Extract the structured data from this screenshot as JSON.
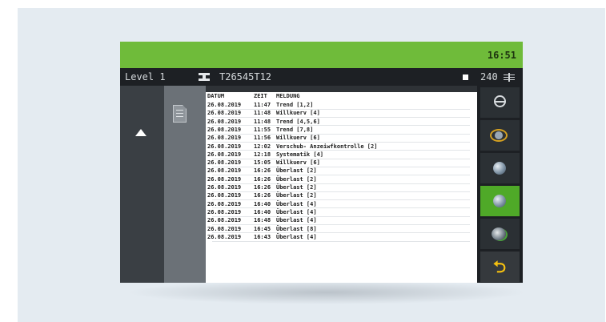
{
  "header": {
    "time": "16:51"
  },
  "status": {
    "level": "Level 1",
    "tool_icon": "tool-icon",
    "serial": "T26545T12",
    "stop_icon": "square-icon",
    "count": "240",
    "count_icon": "count-icon"
  },
  "log": {
    "columns": [
      "DATUM",
      "ZEIT",
      "MELDUNG"
    ],
    "rows": [
      {
        "date": "26.08.2019",
        "time": "11:47",
        "message": "Trend [1,2]"
      },
      {
        "date": "26.08.2019",
        "time": "11:48",
        "message": "Willkuerv [4]"
      },
      {
        "date": "26.08.2019",
        "time": "11:48",
        "message": "Trend [4,5,6]"
      },
      {
        "date": "26.08.2019",
        "time": "11:55",
        "message": "Trend [7,8]"
      },
      {
        "date": "26.08.2019",
        "time": "11:56",
        "message": "Willkuerv [6]"
      },
      {
        "date": "26.08.2019",
        "time": "12:02",
        "message": "Verschub- Anzeiwfkontrolle [2]"
      },
      {
        "date": "26.08.2019",
        "time": "12:18",
        "message": "Systematik [4]"
      },
      {
        "date": "26.08.2019",
        "time": "15:05",
        "message": "Willkuerv [6]"
      },
      {
        "date": "26.08.2019",
        "time": "16:26",
        "message": "Überlast [2]"
      },
      {
        "date": "26.08.2019",
        "time": "16:26",
        "message": "Überlast [2]"
      },
      {
        "date": "26.08.2019",
        "time": "16:26",
        "message": "Überlast [2]"
      },
      {
        "date": "26.08.2019",
        "time": "16:26",
        "message": "Überlast [2]"
      },
      {
        "date": "26.08.2019",
        "time": "16:40",
        "message": "Überlast [4]"
      },
      {
        "date": "26.08.2019",
        "time": "16:40",
        "message": "Überlast [4]"
      },
      {
        "date": "26.08.2019",
        "time": "16:48",
        "message": "Überlast [4]"
      },
      {
        "date": "26.08.2019",
        "time": "16:45",
        "message": "Überlast [8]"
      },
      {
        "date": "26.08.2019",
        "time": "16:43",
        "message": "Überlast [4]"
      }
    ]
  },
  "left": {
    "up_icon": "up-arrow-icon",
    "doc_icon": "document-icon"
  },
  "sidebar": {
    "buttons": [
      {
        "icon": "refresh-icon",
        "active": false
      },
      {
        "icon": "orbit-icon",
        "active": false
      },
      {
        "icon": "sphere-icon",
        "active": false
      },
      {
        "icon": "sphere-icon",
        "active": true
      },
      {
        "icon": "tilt-sphere-icon",
        "active": false
      },
      {
        "icon": "back-icon",
        "active": false
      }
    ]
  },
  "colors": {
    "accent": "#6fbb3a",
    "active": "#4fa928",
    "back_arrow": "#f5c010",
    "background": "#e4ebf1"
  }
}
